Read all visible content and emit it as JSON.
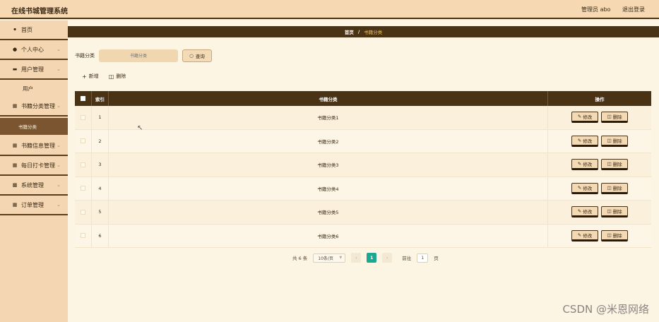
{
  "header": {
    "app_title": "在线书城管理系统",
    "user_label": "管理员 abo",
    "logout_label": "退出登录"
  },
  "sidebar": {
    "items": [
      {
        "label": "首页",
        "icon": "home-icon"
      },
      {
        "label": "个人中心",
        "icon": "user-icon"
      },
      {
        "label": "用户管理",
        "icon": "user-manage-icon"
      },
      {
        "label": "书籍分类管理",
        "icon": "grid-icon"
      },
      {
        "label": "书籍信息管理",
        "icon": "grid-icon"
      },
      {
        "label": "每日打卡管理",
        "icon": "grid-icon"
      },
      {
        "label": "系统管理",
        "icon": "system-icon"
      },
      {
        "label": "订单管理",
        "icon": "grid-icon"
      }
    ],
    "sub_items": {
      "user": "用户",
      "category": "书籍分类"
    }
  },
  "breadcrumb": {
    "home": "首页",
    "separator": "/",
    "current": "书籍分类"
  },
  "search": {
    "label": "书籍分类",
    "placeholder": "书籍分类",
    "button_label": "查询"
  },
  "actions": {
    "add_label": "新增",
    "delete_label": "删除"
  },
  "table": {
    "headers": {
      "index": "索引",
      "name": "书籍分类",
      "operation": "操作"
    },
    "edit_label": "修改",
    "delete_label": "删除",
    "rows": [
      {
        "index": "1",
        "name": "书籍分类1"
      },
      {
        "index": "2",
        "name": "书籍分类2"
      },
      {
        "index": "3",
        "name": "书籍分类3"
      },
      {
        "index": "4",
        "name": "书籍分类4"
      },
      {
        "index": "5",
        "name": "书籍分类5"
      },
      {
        "index": "6",
        "name": "书籍分类6"
      }
    ]
  },
  "pagination": {
    "total": "共 6 条",
    "page_size": "10条/页",
    "current_page": "1",
    "goto_label": "前往",
    "goto_value": "1",
    "page_unit": "页"
  },
  "watermark": "CSDN @米恩网络",
  "colors": {
    "header_bg": "#f6d9b3",
    "dark_brown": "#4a3215",
    "content_bg": "#fdf5e4",
    "accent_teal": "#1aa893",
    "breadcrumb_current": "#f0c060"
  }
}
